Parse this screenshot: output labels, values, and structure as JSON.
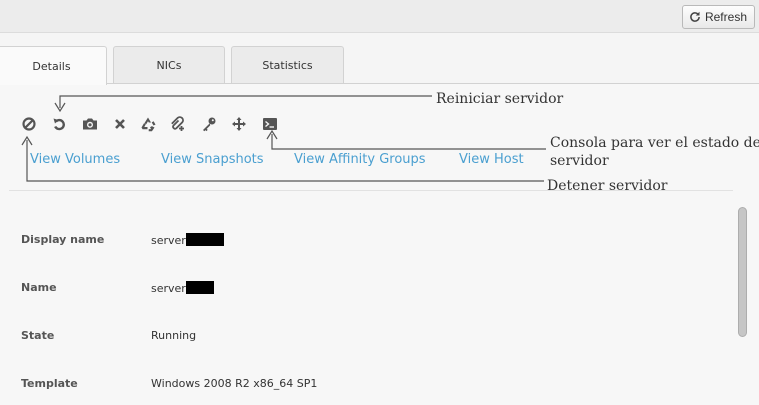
{
  "toolbar": {
    "refresh_label": "Refresh"
  },
  "tabs": [
    {
      "label": "Details",
      "active": true
    },
    {
      "label": "NICs",
      "active": false
    },
    {
      "label": "Statistics",
      "active": false
    }
  ],
  "actions": [
    {
      "icon": "stop-icon",
      "title": "Stop"
    },
    {
      "icon": "reboot-icon",
      "title": "Reboot"
    },
    {
      "icon": "snapshot-icon",
      "title": "Snapshot"
    },
    {
      "icon": "destroy-icon",
      "title": "Destroy"
    },
    {
      "icon": "reinstall-icon",
      "title": "Reinstall"
    },
    {
      "icon": "attach-iso-icon",
      "title": "Attach ISO"
    },
    {
      "icon": "reset-password-icon",
      "title": "Reset password"
    },
    {
      "icon": "migrate-icon",
      "title": "Migrate"
    },
    {
      "icon": "console-icon",
      "title": "Console"
    }
  ],
  "links": {
    "volumes": "View Volumes",
    "snapshots": "View Snapshots",
    "affinity": "View Affinity Groups",
    "host": "View Host"
  },
  "details": {
    "display_name": {
      "label": "Display name",
      "value": "server"
    },
    "name": {
      "label": "Name",
      "value": "server"
    },
    "state": {
      "label": "State",
      "value": "Running"
    },
    "template": {
      "label": "Template",
      "value": "Windows 2008 R2 x86_64 SP1"
    }
  },
  "annotations": {
    "reboot": "Reiniciar servidor",
    "console_line1": "Consola para ver el estado del",
    "console_line2": "servidor",
    "stop": "Detener servidor"
  },
  "colors": {
    "link": "#4a9fd0",
    "icon": "#555555"
  }
}
